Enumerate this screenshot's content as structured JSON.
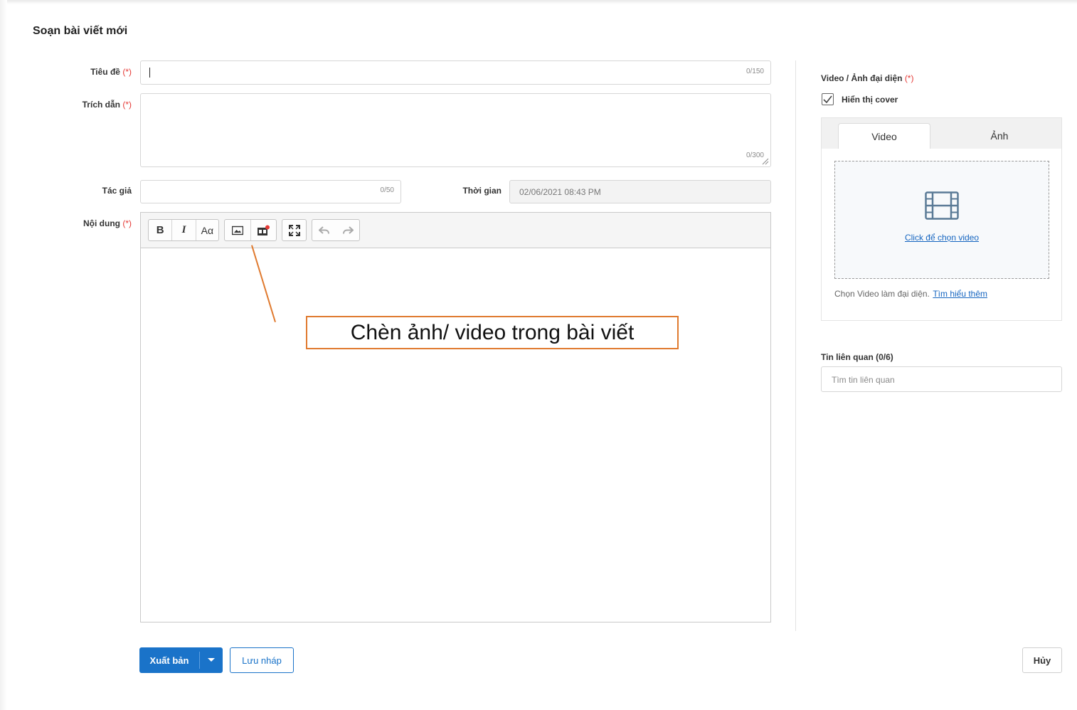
{
  "page": {
    "title": "Soạn bài viết mới"
  },
  "form": {
    "title_field": {
      "label": "Tiêu đề",
      "required_mark": "(*)",
      "value": "",
      "counter": "0/150"
    },
    "excerpt_field": {
      "label": "Trích dẫn",
      "required_mark": "(*)",
      "value": "",
      "counter": "0/300"
    },
    "author_field": {
      "label": "Tác giả",
      "value": "",
      "counter": "0/50"
    },
    "time_field": {
      "label": "Thời gian",
      "value": "02/06/2021 08:43 PM"
    },
    "content_field": {
      "label": "Nội dung",
      "required_mark": "(*)"
    }
  },
  "toolbar": {
    "bold_label": "B",
    "italic_label": "I",
    "font_size_label": "Aα",
    "icons": [
      "image-icon",
      "video-icon",
      "fullscreen-icon",
      "undo-icon",
      "redo-icon"
    ]
  },
  "annotation": {
    "text": "Chèn ảnh/ video trong bài viết",
    "color": "#e07a2f"
  },
  "sidebar": {
    "cover": {
      "label": "Video / Ảnh đại diện",
      "required_mark": "(*)",
      "show_cover_label": "Hiển thị cover",
      "show_cover_checked": true,
      "tabs": [
        {
          "label": "Video",
          "active": true
        },
        {
          "label": "Ảnh",
          "active": false
        }
      ],
      "dropzone_link": "Click để chọn video",
      "hint_text": "Chọn Video làm đại diện.",
      "hint_link": "Tìm hiểu thêm"
    },
    "related": {
      "label": "Tin liên quan (0/6)",
      "placeholder": "Tìm tin liên quan"
    }
  },
  "footer": {
    "publish_label": "Xuất bản",
    "draft_label": "Lưu nháp",
    "cancel_label": "Hủy"
  },
  "colors": {
    "primary": "#1a73c9",
    "required": "#e53935",
    "link": "#1565c0"
  }
}
